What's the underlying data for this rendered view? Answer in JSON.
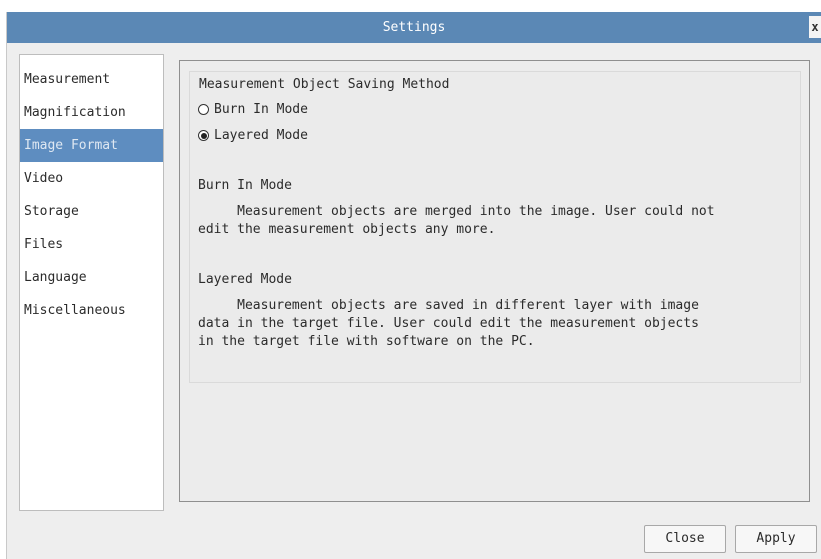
{
  "window": {
    "title": "Settings",
    "close_glyph": "x"
  },
  "sidebar": {
    "items": [
      {
        "label": "Measurement"
      },
      {
        "label": "Magnification"
      },
      {
        "label": "Image Format"
      },
      {
        "label": "Video"
      },
      {
        "label": "Storage"
      },
      {
        "label": "Files"
      },
      {
        "label": "Language"
      },
      {
        "label": "Miscellaneous"
      }
    ],
    "selected": "Image Format"
  },
  "group": {
    "title": "Measurement Object Saving Method",
    "options": [
      {
        "label": "Burn In Mode",
        "checked": false
      },
      {
        "label": "Layered Mode",
        "checked": true
      }
    ],
    "burn_in": {
      "heading": "Burn In Mode",
      "text": "     Measurement objects are merged into the image. User could not\nedit the measurement objects any more."
    },
    "layered": {
      "heading": "Layered Mode",
      "text": "     Measurement objects are saved in different layer with image\ndata in the target file. User could edit the measurement objects\nin the target file with software on the PC."
    }
  },
  "buttons": {
    "close": "Close",
    "apply": "Apply"
  },
  "colors": {
    "titlebar": "#5b88b5",
    "selected_item": "#5e8dc0"
  }
}
